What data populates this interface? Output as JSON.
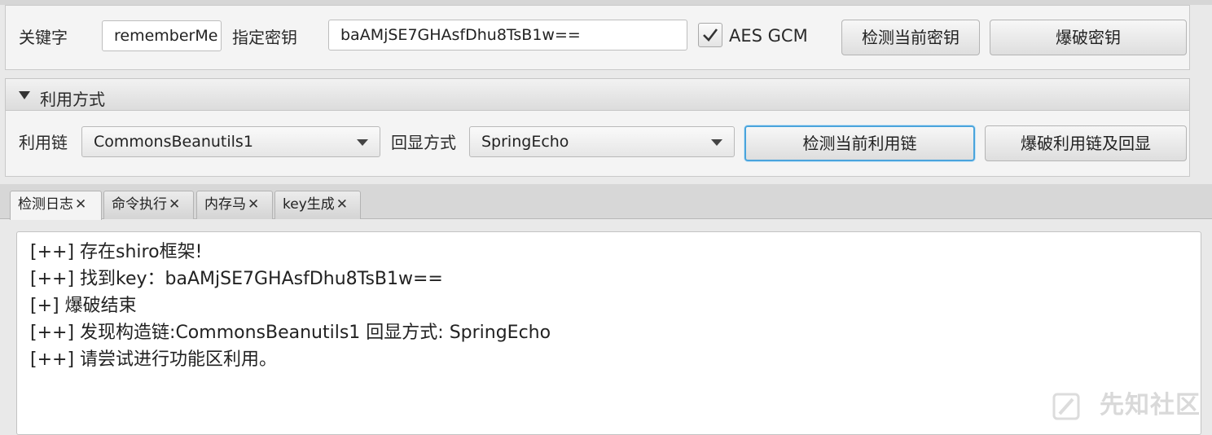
{
  "key_panel": {
    "keyword_label": "关键字",
    "keyword_value": "rememberMe",
    "key_label": "指定密钥",
    "key_value": "baAMjSE7GHAsfDhu8TsB1w==",
    "aes_gcm_label": "AES GCM",
    "aes_gcm_checked": true,
    "detect_key_button": "检测当前密钥",
    "brute_key_button": "爆破密钥"
  },
  "exploit_panel": {
    "title": "利用方式",
    "chain_label": "利用链",
    "chain_value": "CommonsBeanutils1",
    "echo_label": "回显方式",
    "echo_value": "SpringEcho",
    "detect_chain_button": "检测当前利用链",
    "brute_chain_button": "爆破利用链及回显"
  },
  "tabs": [
    {
      "label": "检测日志",
      "selected": true
    },
    {
      "label": "命令执行",
      "selected": false
    },
    {
      "label": "内存马",
      "selected": false
    },
    {
      "label": "key生成",
      "selected": false
    }
  ],
  "tab_close_glyph": "✕",
  "log_lines": [
    "[++] 存在shiro框架!",
    "[++] 找到key：baAMjSE7GHAsfDhu8TsB1w==",
    "[+] 爆破结束",
    "[++] 发现构造链:CommonsBeanutils1  回显方式: SpringEcho",
    "[++] 请尝试进行功能区利用。"
  ],
  "watermark": "先知社区",
  "colors": {
    "focus_border": "#4aa4dc",
    "background": "#e9e9e9"
  }
}
